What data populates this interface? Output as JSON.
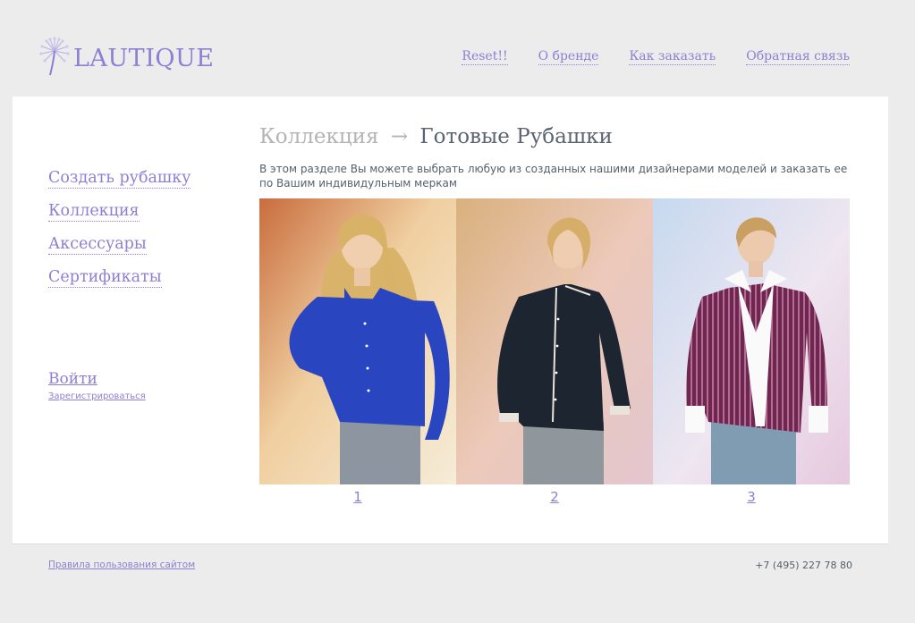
{
  "brand": {
    "logo_text": "LAUTIQUE",
    "accent": "#8e7fd4",
    "icon": "dandelion-icon"
  },
  "topnav": {
    "items": [
      {
        "label": "Reset!!"
      },
      {
        "label": "О бренде"
      },
      {
        "label": "Как заказать"
      },
      {
        "label": "Обратная связь"
      }
    ]
  },
  "sidebar": {
    "items": [
      {
        "label": "Создать рубашку"
      },
      {
        "label": "Коллекция"
      },
      {
        "label": "Аксессуары"
      },
      {
        "label": "Сертификаты"
      }
    ],
    "login_label": "Войти",
    "register_label": "Зарегистрироваться"
  },
  "breadcrumb": {
    "parent": "Коллекция",
    "separator": "→",
    "current": "Готовые Рубашки"
  },
  "description": "В этом разделе Вы можете выбрать любую из созданных нашими дизайнерами моделей и заказать ее по Вашим индивидульным меркам",
  "gallery": [
    {
      "label": "1",
      "shirt": "royal blue shirt",
      "shirt_color": "#2a45c0"
    },
    {
      "label": "2",
      "shirt": "black shirt with white trim",
      "shirt_color": "#1d2530"
    },
    {
      "label": "3",
      "shirt": "purple striped shirt",
      "shirt_color": "#6e2750"
    }
  ],
  "footer": {
    "terms": "Правила пользования сайтом",
    "phone": "+7 (495) 227 78 80"
  }
}
